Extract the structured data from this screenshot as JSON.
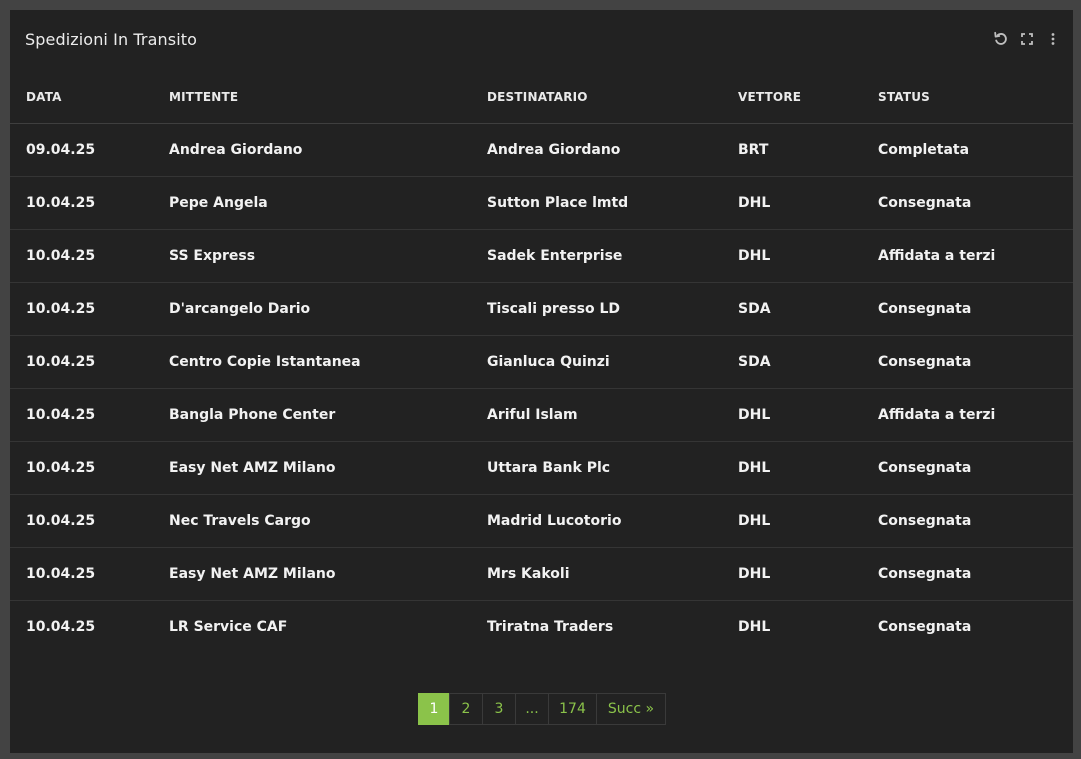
{
  "panel": {
    "title": "Spedizioni In Transito",
    "tools": [
      "refresh-icon",
      "fullscreen-icon",
      "more-vertical-icon"
    ]
  },
  "table": {
    "headers": [
      "DATA",
      "MITTENTE",
      "DESTINATARIO",
      "VETTORE",
      "STATUS"
    ],
    "rows": [
      [
        "09.04.25",
        "Andrea Giordano",
        "Andrea Giordano",
        "BRT",
        "Completata"
      ],
      [
        "10.04.25",
        "Pepe Angela",
        "Sutton Place lmtd",
        "DHL",
        "Consegnata"
      ],
      [
        "10.04.25",
        "SS Express",
        "Sadek Enterprise",
        "DHL",
        "Affidata a terzi"
      ],
      [
        "10.04.25",
        "D'arcangelo Dario",
        "Tiscali presso LD",
        "SDA",
        "Consegnata"
      ],
      [
        "10.04.25",
        "Centro Copie Istantanea",
        "Gianluca Quinzi",
        "SDA",
        "Consegnata"
      ],
      [
        "10.04.25",
        "Bangla Phone Center",
        "Ariful Islam",
        "DHL",
        "Affidata a terzi"
      ],
      [
        "10.04.25",
        "Easy Net AMZ Milano",
        "Uttara Bank Plc",
        "DHL",
        "Consegnata"
      ],
      [
        "10.04.25",
        "Nec Travels Cargo",
        "Madrid Lucotorio",
        "DHL",
        "Consegnata"
      ],
      [
        "10.04.25",
        "Easy Net AMZ Milano",
        "Mrs Kakoli",
        "DHL",
        "Consegnata"
      ],
      [
        "10.04.25",
        "LR Service CAF",
        "Triratna Traders",
        "DHL",
        "Consegnata"
      ]
    ]
  },
  "pagination": {
    "pages": [
      "1",
      "2",
      "3",
      "...",
      "174"
    ],
    "active": "1",
    "next_label": "Succ »"
  },
  "colors": {
    "page_background": "#434343",
    "panel_background": "#222222",
    "accent": "#8bc34a",
    "text": "#f2f2f2"
  }
}
